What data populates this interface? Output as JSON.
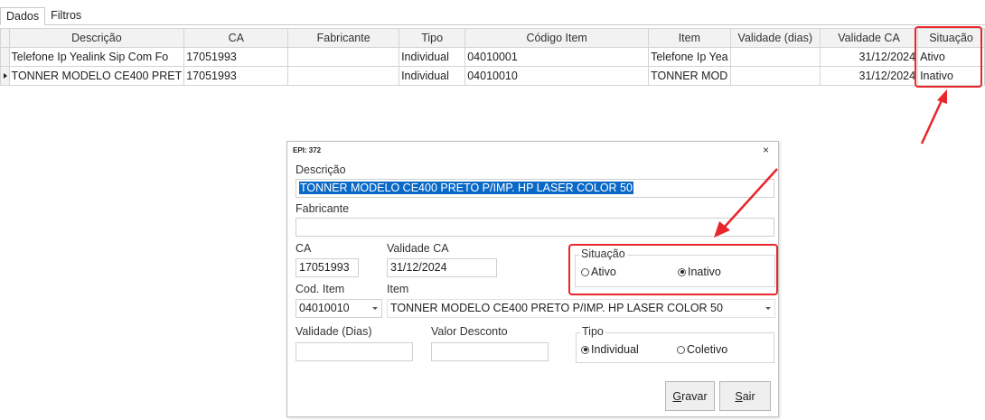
{
  "tabs": [
    {
      "label": "Dados"
    },
    {
      "label": "Filtros"
    }
  ],
  "grid": {
    "headers": [
      "Descrição",
      "CA",
      "Fabricante",
      "Tipo",
      "Código Item",
      "Item",
      "Validade (dias)",
      "Validade CA",
      "Situação"
    ],
    "rows": [
      {
        "descricao": "Telefone Ip Yealink Sip Com Fo",
        "ca": "17051993",
        "fabricante": "",
        "tipo": "Individual",
        "codigo_item": "04010001",
        "item": "Telefone Ip Yea",
        "validade_dias": "",
        "validade_ca": "31/12/2024",
        "situacao": "Ativo"
      },
      {
        "descricao": "TONNER MODELO CE400 PRET",
        "ca": "17051993",
        "fabricante": "",
        "tipo": "Individual",
        "codigo_item": "04010010",
        "item": "TONNER MOD",
        "validade_dias": "",
        "validade_ca": "31/12/2024",
        "situacao": "Inativo"
      }
    ]
  },
  "dialog": {
    "title": "EPI: 372",
    "close": "×",
    "descricao_label": "Descrição",
    "descricao_value": "TONNER MODELO CE400 PRETO P/IMP. HP LASER COLOR 50",
    "fabricante_label": "Fabricante",
    "fabricante_value": "",
    "ca_label": "CA",
    "ca_value": "17051993",
    "validade_ca_label": "Validade CA",
    "validade_ca_value": "31/12/2024",
    "situacao_legend": "Situação",
    "situacao_options": [
      {
        "label": "Ativo",
        "checked": false
      },
      {
        "label": "Inativo",
        "checked": true
      }
    ],
    "cod_item_label": "Cod. Item",
    "cod_item_value": "04010010",
    "item_label": "Item",
    "item_value": "TONNER MODELO CE400 PRETO P/IMP. HP LASER COLOR 50",
    "validade_dias_label": "Validade (Dias)",
    "validade_dias_value": "",
    "valor_desconto_label": "Valor Desconto",
    "valor_desconto_value": "",
    "tipo_legend": "Tipo",
    "tipo_options": [
      {
        "label": "Individual",
        "checked": true
      },
      {
        "label": "Coletivo",
        "checked": false
      }
    ],
    "gravar_first": "G",
    "gravar_rest": "ravar",
    "sair_first": "S",
    "sair_rest": "air"
  },
  "colors": {
    "highlight": "#e8262b",
    "selection": "#0a69c7"
  }
}
